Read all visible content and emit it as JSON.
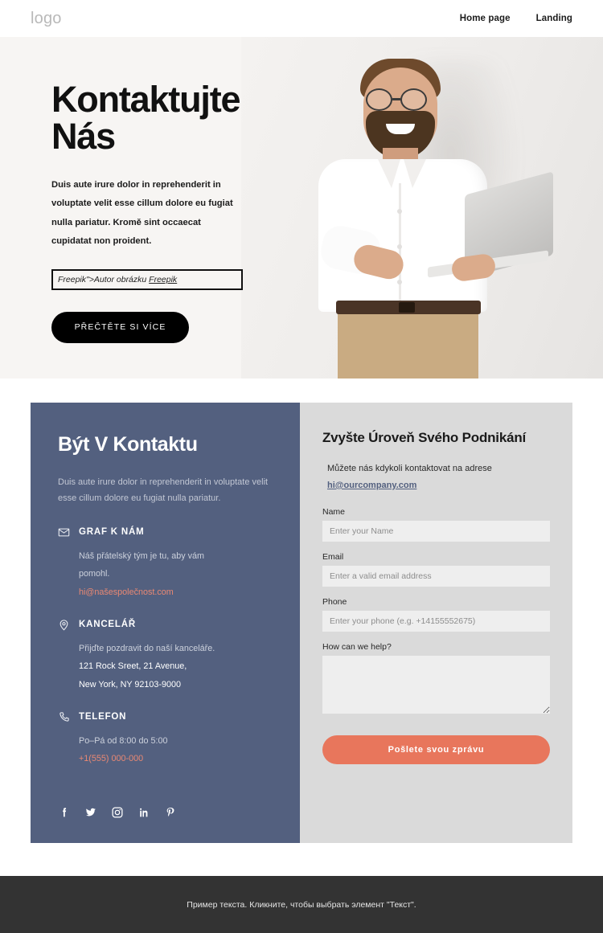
{
  "header": {
    "logo": "logo",
    "nav": [
      {
        "label": "Home page",
        "name": "nav-home-page"
      },
      {
        "label": "Landing",
        "name": "nav-landing"
      }
    ]
  },
  "hero": {
    "title": "Kontaktujte Nás",
    "paragraph": "Duis aute irure dolor in reprehenderit in voluptate velit esse cillum dolore eu fugiat nulla pariatur. Kromě sint occaecat cupidatat non proident.",
    "credit_prefix": "Freepik\">Autor obrázku ",
    "credit_link": "Freepik",
    "cta_label": "PŘEČTĚTE SI VÍCE",
    "image_alt": "smiling-bearded-man-with-glasses-holding-laptop"
  },
  "contact_panel": {
    "title": "Být V Kontaktu",
    "subtitle": "Duis aute irure dolor in reprehenderit in voluptate velit esse cillum dolore eu fugiat nulla pariatur.",
    "blocks": [
      {
        "icon": "envelope-icon",
        "title": "GRAF K NÁM",
        "lines": [
          "Náš přátelský tým je tu, aby vám",
          "pomohl."
        ],
        "link": "hi@našespolečnost.com"
      },
      {
        "icon": "map-pin-icon",
        "title": "KANCELÁŘ",
        "lines": [
          "Přijďte pozdravit do naší kanceláře."
        ],
        "strong_lines": [
          "121 Rock Sreet, 21 Avenue,",
          "New York, NY 92103-9000"
        ]
      },
      {
        "icon": "phone-icon",
        "title": "TELEFON",
        "lines": [
          "Po–Pá od 8:00 do 5:00"
        ],
        "link": "+1(555) 000-000"
      }
    ],
    "socials": [
      "facebook-icon",
      "twitter-icon",
      "instagram-icon",
      "linkedin-icon",
      "pinterest-icon"
    ]
  },
  "form_panel": {
    "title": "Zvyšte Úroveň Svého Podnikání",
    "intro": "Můžete nás kdykoli kontaktovat na adrese",
    "intro_email": "hi@ourcompany.com",
    "fields": [
      {
        "label": "Name",
        "placeholder": "Enter your Name",
        "value": ""
      },
      {
        "label": "Email",
        "placeholder": "Enter a valid email address",
        "value": ""
      },
      {
        "label": "Phone",
        "placeholder": "Enter your phone (e.g. +14155552675)",
        "value": ""
      }
    ],
    "message_label": "How can we help?",
    "message_placeholder": "",
    "message_value": "",
    "submit_label": "Pošlete svou zprávu"
  },
  "footer": {
    "text": "Пример текста. Кликните, чтобы выбрать элемент \"Текст\"."
  },
  "colors": {
    "panel_blue": "#53607f",
    "panel_grey": "#dadada",
    "accent_orange": "#e8765c",
    "hero_bg": "#f7f5f3",
    "footer_bg": "#333333"
  }
}
